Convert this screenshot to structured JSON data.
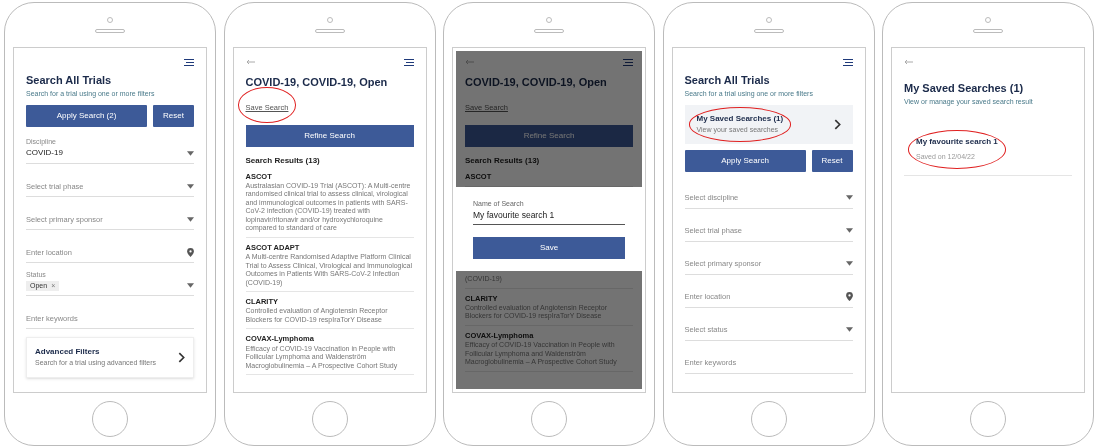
{
  "phones": [
    {
      "kind": "search",
      "back": false,
      "menu": true,
      "title": "Search All Trials",
      "subtitle": "Search for a trial using one or more filters",
      "buttons": [
        {
          "label": "Apply Search (2)",
          "kind": "wide"
        },
        {
          "label": "Reset",
          "kind": "narrow"
        }
      ],
      "fields": [
        {
          "label": "Discipline",
          "value": "COVID-19",
          "kind": "select"
        },
        {
          "placeholder": "Select trial phase",
          "kind": "select"
        },
        {
          "placeholder": "Select primary sponsor",
          "kind": "select"
        },
        {
          "placeholder": "Enter location",
          "kind": "location"
        },
        {
          "label": "Status",
          "chips": [
            {
              "label": "Open",
              "remove": "×"
            }
          ],
          "kind": "select"
        },
        {
          "placeholder": "Enter keywords",
          "kind": "text"
        }
      ],
      "card": {
        "title": "Advanced Filters",
        "subtitle": "Search for a trial using advanced filters"
      }
    },
    {
      "kind": "results",
      "back": true,
      "menu": true,
      "dimmed": false,
      "title": "COVID-19, COVID-19, Open",
      "link": {
        "label": "Save Search",
        "highlighted": true
      },
      "button": "Refine Search",
      "heading": "Search Results (13)",
      "results": [
        {
          "kind": "result",
          "title": "ASCOT",
          "desc": "Australasian COVID-19 Trial (ASCOT): A Multi-centre randomised clinical trial to assess clinical, virological and immunological outcomes in patients with SARS-CoV-2 infection (COVID-19) treated with lopinavir/ritonavir and/or hydroxychloroquine compared to standard of care"
        },
        {
          "kind": "result",
          "title": "ASCOT ADAPT",
          "desc": "A Multi-centre Randomised Adaptive Platform Clinical Trial to Assess Clinical, Virological and Immunological Outcomes in Patients With SARS-CoV-2 Infection (COVID-19)"
        },
        {
          "kind": "result",
          "title": "CLARITY",
          "desc": "Controlled evaluation of Angiotensin Receptor Blockers for COVID-19 respIraTorY Disease"
        },
        {
          "kind": "result",
          "title": "COVAX-Lymphoma",
          "desc": "Efficacy of COVID-19 Vaccination in People with Follicular Lymphoma and Waldenström Macroglobulinemia – A Prospective Cohort Study"
        }
      ]
    },
    {
      "kind": "results",
      "back": true,
      "menu": true,
      "dimmed": true,
      "title": "COVID-19, COVID-19, Open",
      "link": {
        "label": "Save Search"
      },
      "button": "Refine Search",
      "heading": "Search Results (13)",
      "results": [
        {
          "kind": "result",
          "title": "ASCOT"
        },
        {
          "kind": "dialog",
          "label": "Name of Search",
          "value": "My favourite search 1",
          "button": "Save"
        },
        {
          "kind": "result",
          "desc": "(COVID-19)"
        },
        {
          "kind": "result",
          "title": "CLARITY",
          "desc": "Controlled evaluation of Angiotensin Receptor Blockers for COVID-19 respIraTorY Disease"
        },
        {
          "kind": "result",
          "title": "COVAX-Lymphoma",
          "desc": "Efficacy of COVID-19 Vaccination in People with Follicular Lymphoma and Waldenström Macroglobulinemia – A Prospective Cohort Study"
        }
      ]
    },
    {
      "kind": "search",
      "back": false,
      "menu": true,
      "title": "Search All Trials",
      "subtitle": "Search for a trial using one or more filters",
      "saved": {
        "title": "My Saved Searches (1)",
        "subtitle": "View your saved searches",
        "highlighted": true
      },
      "buttons": [
        {
          "label": "Apply Search",
          "kind": "wide"
        },
        {
          "label": "Reset",
          "kind": "narrow"
        }
      ],
      "fields": [
        {
          "placeholder": "Select discipline",
          "kind": "select"
        },
        {
          "placeholder": "Select trial phase",
          "kind": "select"
        },
        {
          "placeholder": "Select primary sponsor",
          "kind": "select"
        },
        {
          "placeholder": "Enter location",
          "kind": "location"
        },
        {
          "placeholder": "Select status",
          "kind": "select"
        },
        {
          "placeholder": "Enter keywords",
          "kind": "text"
        }
      ]
    },
    {
      "kind": "saved",
      "back": true,
      "menu": false,
      "title": "My Saved Searches (1)",
      "subtitle": "View or manage your saved search result",
      "items": [
        {
          "title": "My favourite search 1",
          "date": "Saved on 12/04/22",
          "highlighted": true
        }
      ]
    }
  ]
}
